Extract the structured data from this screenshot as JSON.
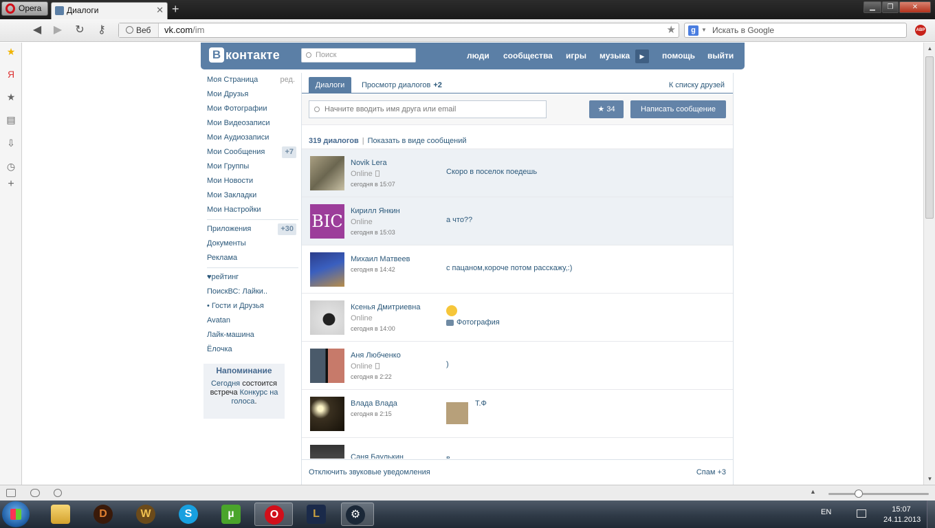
{
  "browser": {
    "menu_label": "Opera",
    "tab_title": "Диалоги",
    "url_prefix": "Веб",
    "url_domain": "vk.com",
    "url_path": "/im",
    "search_placeholder": "Искать в Google",
    "adblock_label": "ABP"
  },
  "vk": {
    "logo_letter": "В",
    "logo_text": "контакте",
    "search_placeholder": "Поиск",
    "nav": [
      "люди",
      "сообщества",
      "игры",
      "музыка",
      "помощь",
      "выйти"
    ]
  },
  "left_menu": {
    "items": [
      {
        "label": "Моя Страница",
        "extra": "ред."
      },
      {
        "label": "Мои Друзья"
      },
      {
        "label": "Мои Фотографии"
      },
      {
        "label": "Мои Видеозаписи"
      },
      {
        "label": "Мои Аудиозаписи"
      },
      {
        "label": "Мои Сообщения",
        "badge": "+7"
      },
      {
        "label": "Мои Группы"
      },
      {
        "label": "Мои Новости"
      },
      {
        "label": "Мои Закладки"
      },
      {
        "label": "Мои Настройки"
      }
    ],
    "apps": [
      {
        "label": "Приложения",
        "badge": "+30"
      },
      {
        "label": "Документы"
      },
      {
        "label": "Реклама"
      }
    ],
    "extra": [
      "♥рейтинг",
      "ПоискВС: Лайки..",
      "• Гости и Друзья",
      "Avatan",
      "Лайк-машина",
      "Ёлочка"
    ]
  },
  "reminder": {
    "title": "Напоминание",
    "link1": "Сегодня",
    "text1": "состоится встреча",
    "link2": "Конкурс на голоса",
    "dot": "."
  },
  "dialogs": {
    "tab_active": "Диалоги",
    "tab_view": "Просмотр диалогов",
    "tab_view_count": "+2",
    "to_friends": "К списку друзей",
    "search_placeholder": "Начните вводить имя друга или email",
    "fav_count": "34",
    "write_button": "Написать сообщение",
    "count": "319 диалогов",
    "show_as_messages": "Показать в виде сообщений",
    "items": [
      {
        "name": "Novik Lera",
        "status": "Online",
        "time": "сегодня в 15:07",
        "message": "Скоро в поселок поедешь"
      },
      {
        "name": "Кирилл Янкин",
        "status": "Online",
        "time": "сегодня в 15:03",
        "message": "а что??"
      },
      {
        "name": "Михаил Матвеев",
        "status": "",
        "time": "сегодня в 14:42",
        "message": "с пацаном,короче потом расскажу,:)"
      },
      {
        "name": "Ксенья Дмитриевна",
        "status": "Online",
        "time": "сегодня в 14:00",
        "message": "Фотография"
      },
      {
        "name": "Аня Любченко",
        "status": "Online",
        "time": "сегодня в 2:22",
        "message": ")"
      },
      {
        "name": "Влада Влада",
        "status": "",
        "time": "сегодня в 2:15",
        "message": "Т.Ф"
      },
      {
        "name": "Саня Баулькин",
        "status": "",
        "time": "",
        "message": "в"
      }
    ],
    "avatar_text_2": "BIC",
    "footer_mute": "Отключить звуковые уведомления",
    "footer_spam": "Спам +3"
  },
  "taskbar": {
    "lang": "EN",
    "time": "15:07",
    "date": "24.11.2013"
  },
  "colors": {
    "vk_blue": "#5b7fa6",
    "link": "#2b587a",
    "unread_bg": "#edf1f5"
  }
}
